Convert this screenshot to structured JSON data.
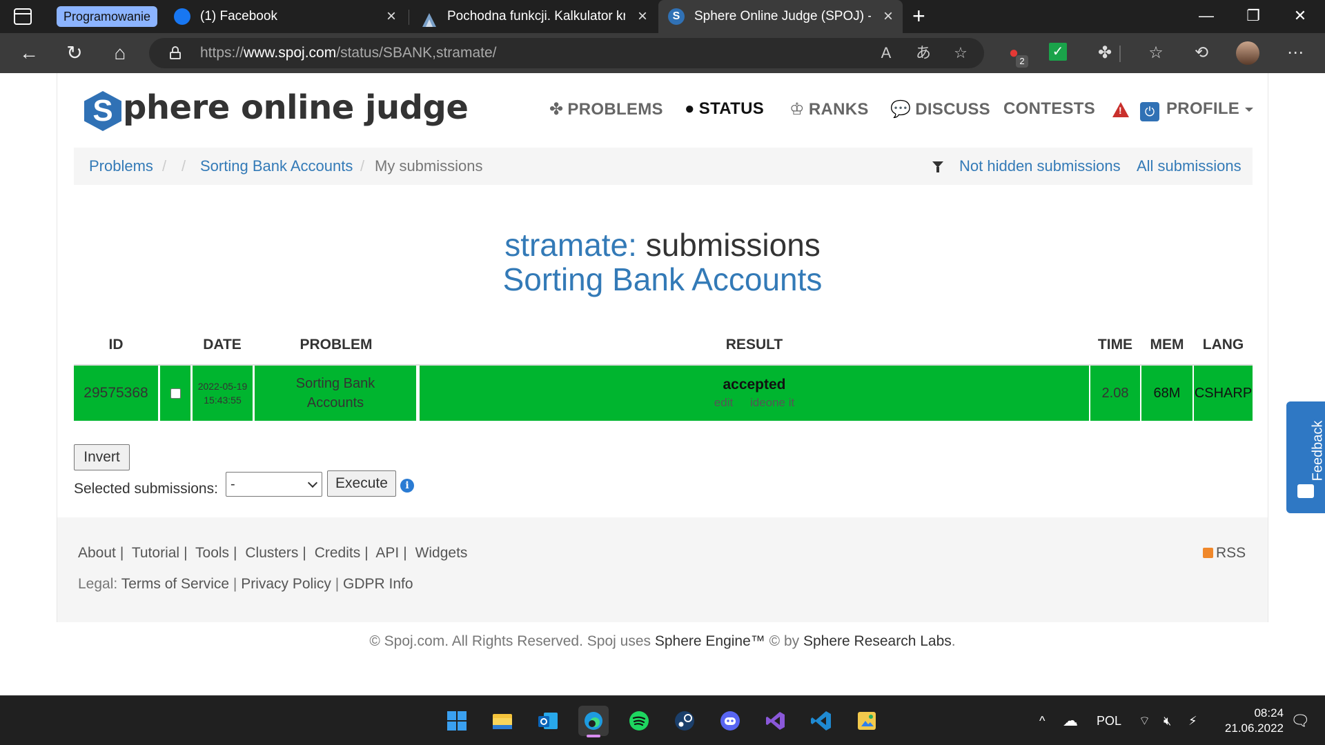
{
  "browser": {
    "tab_group_label": "Programowanie",
    "tabs": [
      {
        "title": "(1) Facebook",
        "icon": "facebook-icon"
      },
      {
        "title": "Pochodna funkcji. Kalkulator krok po kroku",
        "icon": "calculator-site-icon"
      },
      {
        "title": "Sphere Online Judge (SPOJ) - Status",
        "icon": "spoj-icon"
      }
    ],
    "url_prefix": "https://",
    "url_host": "www.spoj.com",
    "url_path": "/status/SBANK,stramate/",
    "extension_badge": "2"
  },
  "site": {
    "logo_letter": "S",
    "logo_text": "phere online judge",
    "nav": {
      "problems": "PROBLEMS",
      "status": "STATUS",
      "ranks": "RANKS",
      "discuss": "DISCUSS",
      "contests": "CONTESTS",
      "profile": "PROFILE"
    }
  },
  "breadcrumb": {
    "problems": "Problems",
    "sep": "/",
    "problem": "Sorting Bank Accounts",
    "current": "My submissions",
    "not_hidden": "Not hidden submissions",
    "all": "All submissions"
  },
  "heading": {
    "user": "stramate:",
    "suffix": "submissions",
    "problem": "Sorting Bank Accounts"
  },
  "table": {
    "headers": {
      "id": "ID",
      "date": "DATE",
      "problem": "PROBLEM",
      "result": "RESULT",
      "time": "TIME",
      "mem": "MEM",
      "lang": "LANG"
    },
    "rows": [
      {
        "id": "29575368",
        "date": "2022-05-19",
        "time_of_day": "15:43:55",
        "problem": "Sorting Bank Accounts",
        "result": "accepted",
        "edit": "edit",
        "ideone": "ideone it",
        "time": "2.08",
        "mem": "68M",
        "lang": "CSHARP"
      }
    ],
    "accepted_color": "#00b52f"
  },
  "controls": {
    "invert": "Invert",
    "selected_label": "Selected submissions:",
    "select_value": "-",
    "execute": "Execute"
  },
  "footer": {
    "links": [
      "About",
      "Tutorial",
      "Tools",
      "Clusters",
      "Credits",
      "API",
      "Widgets"
    ],
    "legal_label": "Legal:",
    "legal": [
      "Terms of Service",
      "Privacy Policy",
      "GDPR Info"
    ],
    "rss": "RSS",
    "copyright_a": "© Spoj.com. All Rights Reserved. Spoj uses",
    "engine": "Sphere Engine™",
    "copyright_b": "© by",
    "labs": "Sphere Research Labs",
    "period": "."
  },
  "feedback": "Feedback",
  "taskbar": {
    "language": "POL",
    "time": "08:24",
    "date": "21.06.2022"
  }
}
